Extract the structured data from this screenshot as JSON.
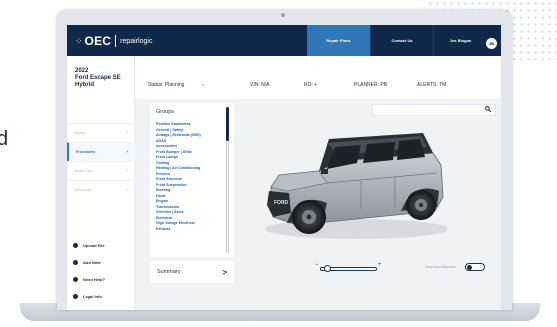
{
  "page": {
    "edge_text": "d"
  },
  "header": {
    "logo_mark": "⁘",
    "brand": "OEC",
    "brand_sub": "repairlogic",
    "nav": [
      {
        "label": "Repair Plans",
        "active": true
      },
      {
        "label": "Contact Us",
        "active": false
      }
    ],
    "user": {
      "name": "Joe Blogan",
      "initials": "JB"
    }
  },
  "sidebar": {
    "vehicle_year": "2022",
    "vehicle_model": "Ford Escape SE",
    "vehicle_trim": "Hybrid",
    "items": [
      {
        "label": "Vehicle",
        "active": false
      },
      {
        "label": "Procedures",
        "active": true
      },
      {
        "label": "Repair Plan",
        "active": false
      },
      {
        "label": "Workspace",
        "active": false
      }
    ],
    "links": [
      {
        "label": "Upload File"
      },
      {
        "label": "Add Note"
      },
      {
        "label": "Need Help?"
      },
      {
        "label": "Legal Info"
      }
    ]
  },
  "status_bar": {
    "status": "Status: Planning",
    "vin": "VIN: N/A",
    "ro": "RO: +",
    "planner": "PLANNER: PB",
    "alerts": "ALERTS: TM"
  },
  "groups": {
    "title": "Groups",
    "items": [
      "Position Statements",
      "General | Safety",
      "Airbags | Restraints (SRS)",
      "ADAS",
      "Accessories",
      "Front Bumper | Grille",
      "Front Lamps",
      "Cooling",
      "Heating | Air Conditioning",
      "Fenders",
      "Front Structure",
      "Front Suspension",
      "Steering",
      "Hood",
      "Engine",
      "Transmission",
      "Driveline | Axles",
      "Electrical",
      "High Voltage Electrical",
      "Exhaust"
    ]
  },
  "summary": {
    "label": "Summary",
    "arrow": ">"
  },
  "search": {
    "placeholder": ""
  },
  "viewer": {
    "zoom_minus": "−",
    "zoom_plus": "+",
    "zoom_level": 0.05,
    "inner_structure_label": "View Inner Structure",
    "inner_structure_on": false
  },
  "colors": {
    "nav_bg": "#10284a",
    "nav_active": "#2f77b8",
    "link_blue": "#1f5fa5",
    "panel_bg": "#f1f2f4"
  }
}
